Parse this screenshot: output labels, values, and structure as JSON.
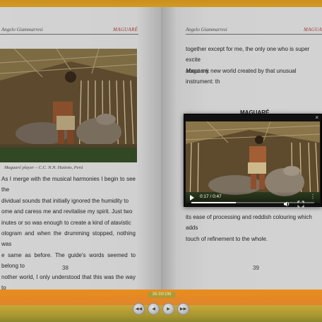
{
  "book": {
    "left_page": {
      "author": "Angelo Giammarresi",
      "title": "MAGUARÉ",
      "caption": "Maguaré player – C.C. N.N. Huitoto, Perú",
      "text": "As I merge with the musical harmonies I begin to see the\ndividual sounds that initially ignored the humidity to\nome and caress me and revitalise my spirit. Just two\ninutes or so was enough to create a kind of atavistic\nologram and when the drumming stopped, nothing was\ne same as before. The guide's words seemed to belong to\nnother world, I only understood that this was the way to\nelcome the guests. I look around and see everyone sitting",
      "page_number": "38"
    },
    "right_page": {
      "author": "Angelo Giammarresi",
      "title": "MAGUARÉ",
      "text_top": "together except for me, the only one who is super excite\nabout my new world created by that unusual instrument: th",
      "text_top_italic": "Maguaré.",
      "section_title": "MAGUARÉ",
      "text_bottom": "its ease of processing and reddish colouring which adds\ntouch of refinement to the whole.",
      "page_number": "39"
    }
  },
  "video_player": {
    "close_label": "×",
    "time": "0:17 / 0:47",
    "progress_fraction": 0.36,
    "controls": [
      "play-icon",
      "volume-icon",
      "fullscreen-icon",
      "more-options-icon"
    ]
  },
  "footer": {
    "page_indicator": "38-39/198",
    "nav": {
      "first": "◀◀",
      "prev": "◀",
      "next": "▶",
      "last": "▶▶"
    }
  },
  "colors": {
    "title_red": "#b3403c",
    "footer_orange": "#e98d1c",
    "footer_bar": "#a89730"
  }
}
